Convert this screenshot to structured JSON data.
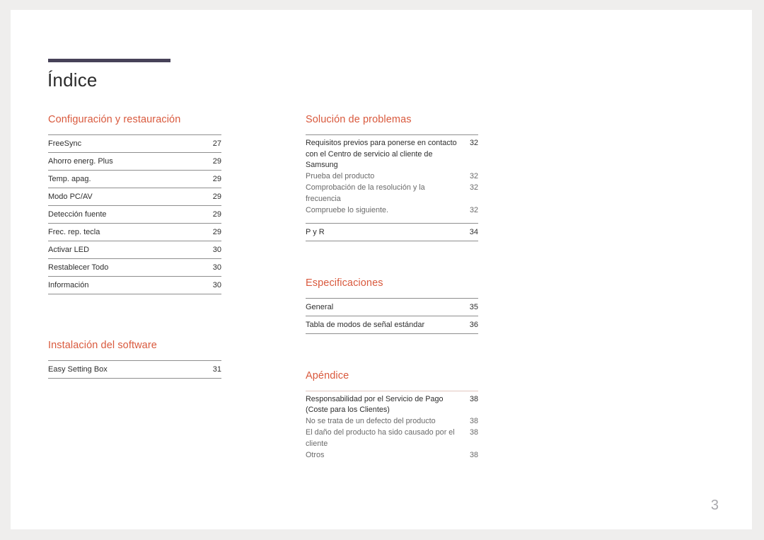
{
  "document": {
    "title": "Índice",
    "page_number": "3",
    "accent_color": "#d9593d",
    "rule_color": "#8e8e8e",
    "title_bar_color": "#474258",
    "page_number_color": "#a8a8ad"
  },
  "columns": {
    "left": [
      {
        "heading": "Configuración y restauración",
        "entries": [
          {
            "label": "FreeSync",
            "page": "27",
            "type": "main"
          },
          {
            "label": "Ahorro energ. Plus",
            "page": "29",
            "type": "main"
          },
          {
            "label": "Temp. apag.",
            "page": "29",
            "type": "main"
          },
          {
            "label": "Modo PC/AV",
            "page": "29",
            "type": "main"
          },
          {
            "label": "Detección fuente",
            "page": "29",
            "type": "main"
          },
          {
            "label": "Frec. rep. tecla",
            "page": "29",
            "type": "main"
          },
          {
            "label": "Activar LED",
            "page": "30",
            "type": "main"
          },
          {
            "label": "Restablecer Todo",
            "page": "30",
            "type": "main"
          },
          {
            "label": "Información",
            "page": "30",
            "type": "main"
          }
        ]
      },
      {
        "heading": "Instalación del software",
        "entries": [
          {
            "label": "Easy Setting Box",
            "page": "31",
            "type": "main"
          }
        ]
      }
    ],
    "right": [
      {
        "heading": "Solución de problemas",
        "entries": [
          {
            "label": "Requisitos previos para ponerse en contacto\ncon el Centro de servicio al cliente de Samsung",
            "page": "32",
            "type": "lead"
          },
          {
            "label": "Prueba del producto",
            "page": "32",
            "type": "sub"
          },
          {
            "label": "Comprobación de la resolución y la frecuencia",
            "page": "32",
            "type": "sub"
          },
          {
            "label": "Compruebe lo siguiente.",
            "page": "32",
            "type": "sub"
          },
          {
            "label": "P y R",
            "page": "34",
            "type": "main"
          }
        ]
      },
      {
        "heading": "Especificaciones",
        "entries": [
          {
            "label": "General",
            "page": "35",
            "type": "main"
          },
          {
            "label": "Tabla de modos de señal estándar",
            "page": "36",
            "type": "main"
          }
        ]
      },
      {
        "heading": "Apéndice",
        "entries": [
          {
            "label": "Responsabilidad por el Servicio de Pago\n(Coste para los Clientes)",
            "page": "38",
            "type": "lead"
          },
          {
            "label": "No se trata de un defecto del producto",
            "page": "38",
            "type": "sub"
          },
          {
            "label": "El daño del producto ha sido causado por el\ncliente",
            "page": "38",
            "type": "sub"
          },
          {
            "label": "Otros",
            "page": "38",
            "type": "sub"
          }
        ]
      }
    ]
  }
}
